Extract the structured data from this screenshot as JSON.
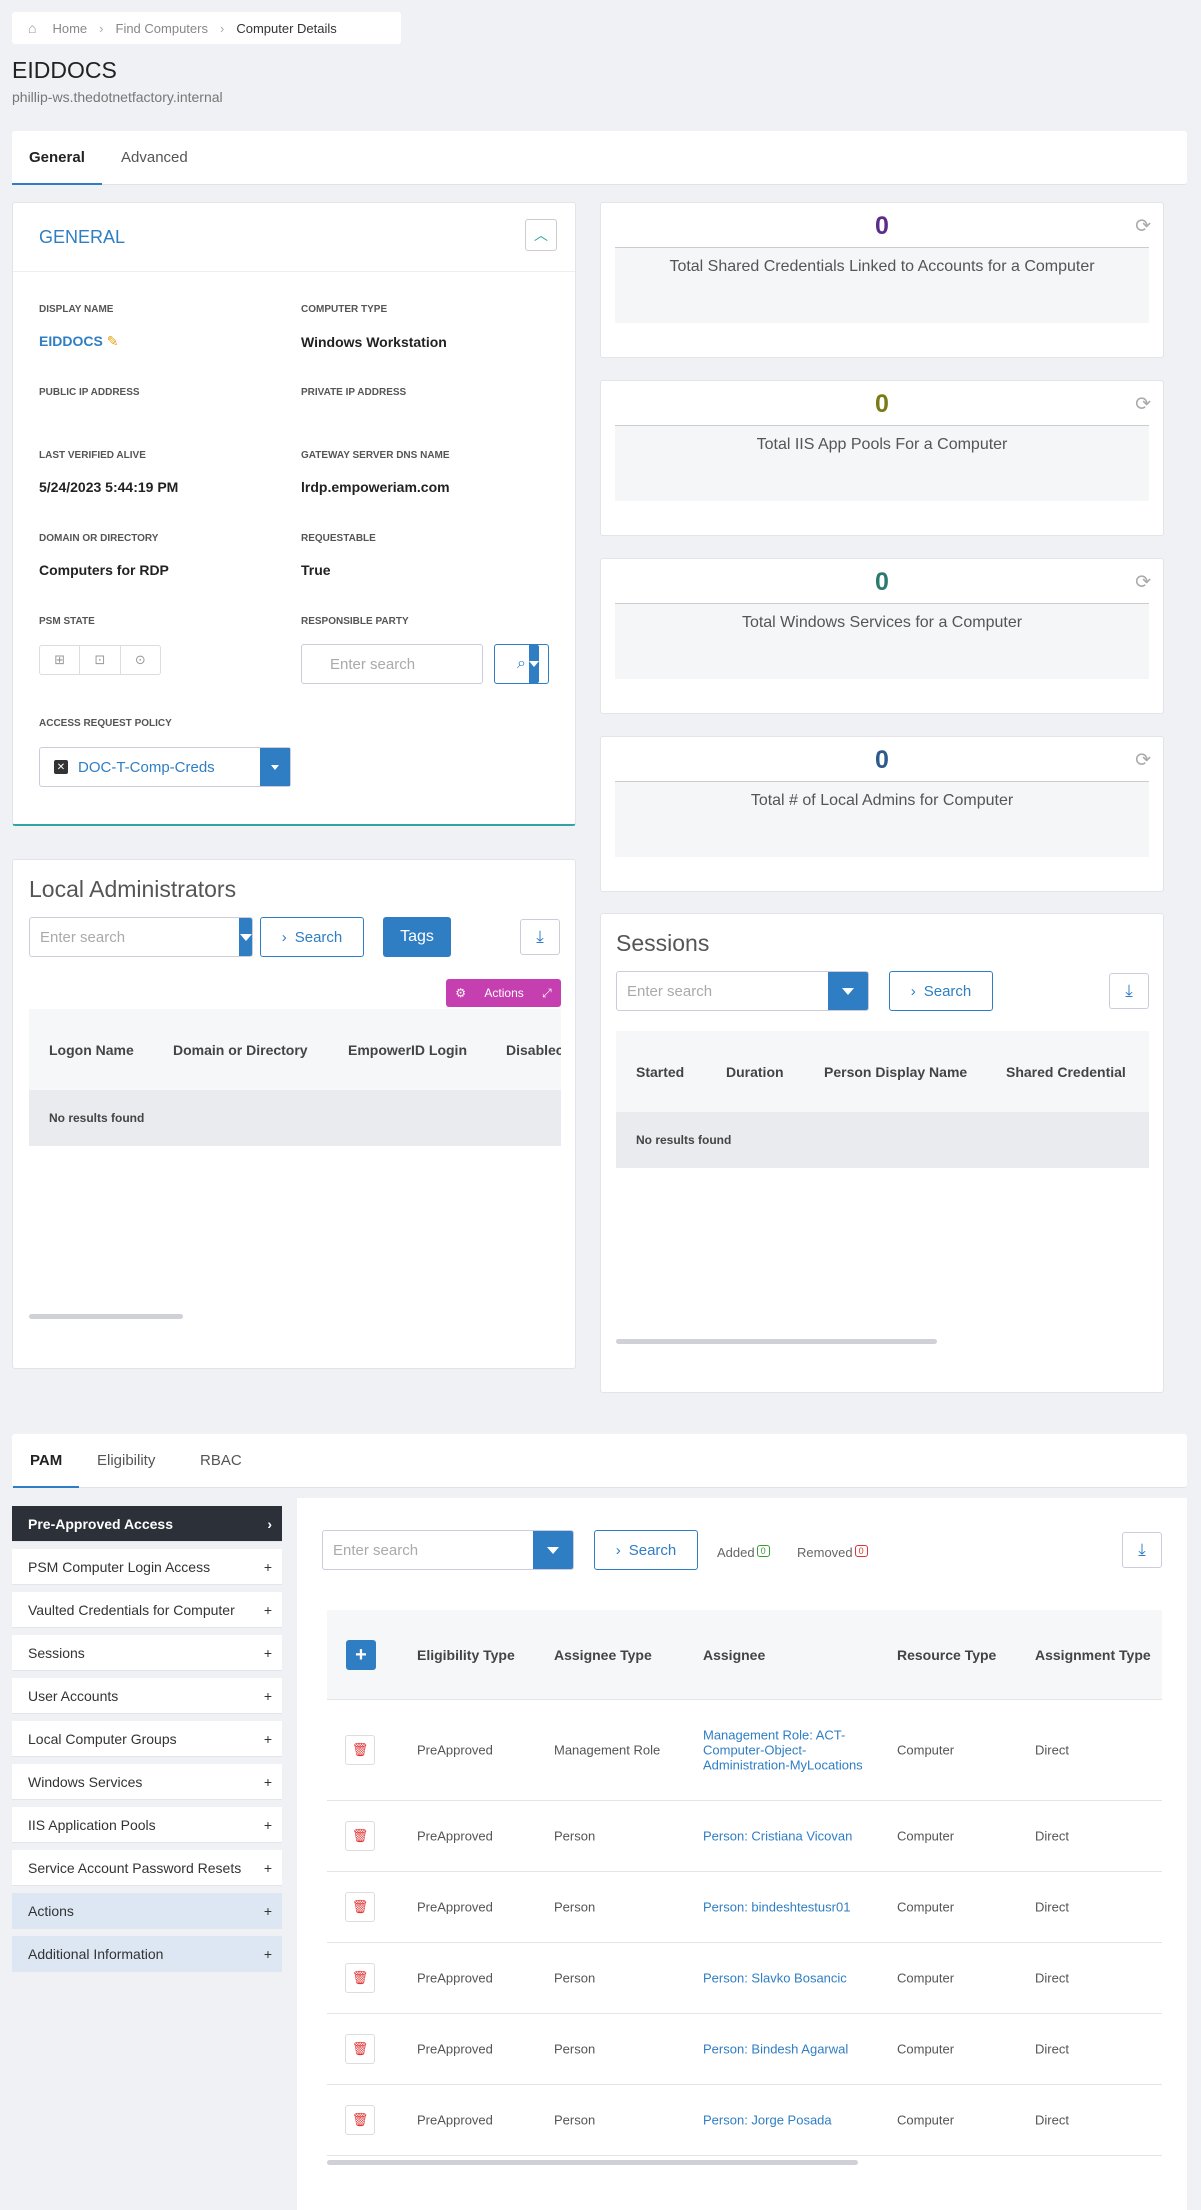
{
  "breadcrumb": {
    "home": "Home",
    "find": "Find Computers",
    "current": "Computer Details"
  },
  "header": {
    "title": "EIDDOCS",
    "subtitle": "phillip-ws.thedotnetfactory.internal"
  },
  "top_tabs": [
    {
      "label": "General"
    },
    {
      "label": "Advanced"
    }
  ],
  "general": {
    "title": "GENERAL",
    "display_name_label": "DISPLAY NAME",
    "display_name": "EIDDOCS",
    "computer_type_label": "COMPUTER TYPE",
    "computer_type": "Windows Workstation",
    "public_ip_label": "PUBLIC IP ADDRESS",
    "private_ip_label": "PRIVATE IP ADDRESS",
    "last_verified_label": "LAST VERIFIED ALIVE",
    "last_verified": "5/24/2023 5:44:19 PM",
    "gateway_label": "GATEWAY SERVER DNS NAME",
    "gateway": "lrdp.empoweriam.com",
    "domain_label": "DOMAIN OR DIRECTORY",
    "domain": "Computers for RDP",
    "requestable_label": "REQUESTABLE",
    "requestable": "True",
    "psm_state_label": "PSM STATE",
    "responsible_label": "RESPONSIBLE PARTY",
    "responsible_placeholder": "Enter search",
    "policy_label": "ACCESS REQUEST POLICY",
    "policy": "DOC-T-Comp-Creds"
  },
  "stats": [
    {
      "value": "0",
      "label": "Total Shared Credentials Linked to Accounts for a Computer",
      "color": "#5a2d8c"
    },
    {
      "value": "0",
      "label": "Total IIS App Pools For a Computer",
      "color": "#7a7a16"
    },
    {
      "value": "0",
      "label": "Total Windows Services for a Computer",
      "color": "#2c7a6e"
    },
    {
      "value": "0",
      "label": "Total # of Local Admins for Computer",
      "color": "#2c5a8c"
    }
  ],
  "local_admins": {
    "title": "Local Administrators",
    "placeholder": "Enter search",
    "search": "Search",
    "tags": "Tags",
    "actions": "Actions",
    "columns": [
      "Logon Name",
      "Domain or Directory",
      "EmpowerID Login",
      "Disablec"
    ],
    "empty": "No results found"
  },
  "sessions": {
    "title": "Sessions",
    "placeholder": "Enter search",
    "search": "Search",
    "columns": [
      "Started",
      "Duration",
      "Person Display Name",
      "Shared Credential"
    ],
    "empty": "No results found"
  },
  "bottom_tabs": [
    {
      "label": "PAM"
    },
    {
      "label": "Eligibility"
    },
    {
      "label": "RBAC"
    }
  ],
  "sidebar": [
    {
      "label": "Pre-Approved Access",
      "mark": "›"
    },
    {
      "label": "PSM Computer Login Access",
      "mark": "+"
    },
    {
      "label": "Vaulted Credentials for Computer",
      "mark": "+"
    },
    {
      "label": "Sessions",
      "mark": "+"
    },
    {
      "label": "User Accounts",
      "mark": "+"
    },
    {
      "label": "Local Computer Groups",
      "mark": "+"
    },
    {
      "label": "Windows Services",
      "mark": "+"
    },
    {
      "label": "IIS Application Pools",
      "mark": "+"
    },
    {
      "label": "Service Account Password Resets",
      "mark": "+"
    },
    {
      "label": "Actions",
      "mark": "+"
    },
    {
      "label": "Additional Information",
      "mark": "+"
    }
  ],
  "pam": {
    "placeholder": "Enter search",
    "search": "Search",
    "added_label": "Added",
    "added_count": "0",
    "removed_label": "Removed",
    "removed_count": "0",
    "columns": [
      "Eligibility Type",
      "Assignee Type",
      "Assignee",
      "Resource Type",
      "Assignment Type"
    ],
    "rows": [
      {
        "eligibility": "PreApproved",
        "assignee_type": "Management Role",
        "assignee": "Management Role: ACT-Computer-Object-Administration-MyLocations",
        "resource": "Computer",
        "assignment": "Direct"
      },
      {
        "eligibility": "PreApproved",
        "assignee_type": "Person",
        "assignee": "Person: Cristiana Vicovan",
        "resource": "Computer",
        "assignment": "Direct"
      },
      {
        "eligibility": "PreApproved",
        "assignee_type": "Person",
        "assignee": "Person: bindeshtestusr01",
        "resource": "Computer",
        "assignment": "Direct"
      },
      {
        "eligibility": "PreApproved",
        "assignee_type": "Person",
        "assignee": "Person: Slavko Bosancic",
        "resource": "Computer",
        "assignment": "Direct"
      },
      {
        "eligibility": "PreApproved",
        "assignee_type": "Person",
        "assignee": "Person: Bindesh Agarwal",
        "resource": "Computer",
        "assignment": "Direct"
      },
      {
        "eligibility": "PreApproved",
        "assignee_type": "Person",
        "assignee": "Person: Jorge Posada",
        "resource": "Computer",
        "assignment": "Direct"
      }
    ]
  }
}
